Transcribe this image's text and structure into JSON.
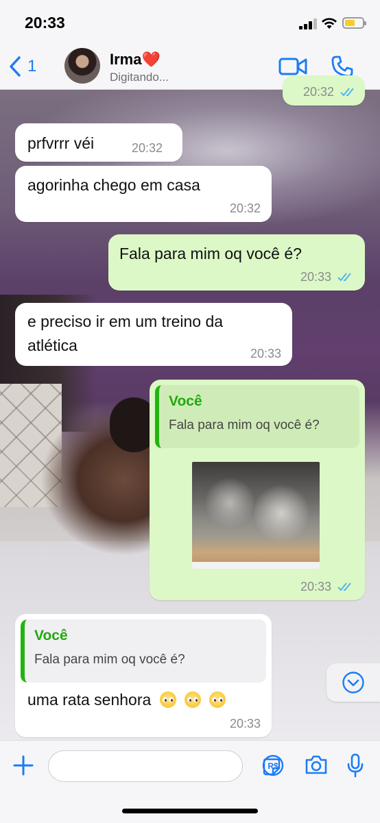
{
  "status_bar": {
    "time": "20:33"
  },
  "header": {
    "back_count": "1",
    "contact_name": "Irma❤️",
    "contact_status": "Digitando..."
  },
  "messages": [
    {
      "direction": "out",
      "time": "20:32",
      "partial": true
    },
    {
      "direction": "in",
      "text": "prfvrrr véi",
      "time": "20:32"
    },
    {
      "direction": "in",
      "text": "agorinha chego em casa",
      "time": "20:32"
    },
    {
      "direction": "out",
      "text": "Fala para mim oq você é?",
      "time": "20:33"
    },
    {
      "direction": "in",
      "text_line1": "e preciso ir em um treino da",
      "text_line2": "atlética",
      "time": "20:33"
    },
    {
      "direction": "out",
      "quote_name": "Você",
      "quote_text": "Fala para mim oq você é?",
      "media": "video-thumbnail",
      "time": "20:33"
    },
    {
      "direction": "in",
      "quote_name": "Você",
      "quote_text": "Fala para mim oq você é?",
      "text": "uma rata senhora",
      "emojis": [
        "pleading-face",
        "pleading-face",
        "pleading-face"
      ],
      "time": "20:33"
    }
  ],
  "colors": {
    "accent": "#1b7cf5",
    "outgoing_bubble": "#dcf8c6",
    "incoming_bubble": "#ffffff",
    "quote_accent": "#24b312",
    "read_ticks": "#4fb4f0"
  },
  "icons": {
    "back": "chevron-left-icon",
    "video": "video-camera-icon",
    "call": "phone-icon",
    "scroll": "chevron-down-circle-icon",
    "plus": "plus-icon",
    "sticker": "sticker-icon",
    "pay": "brl-payment-icon",
    "camera": "camera-icon",
    "mic": "microphone-icon"
  }
}
